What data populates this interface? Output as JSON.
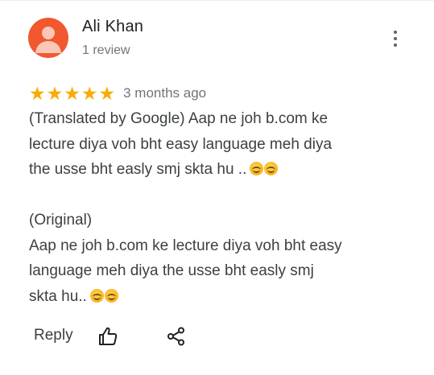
{
  "review": {
    "author_name": "Ali Khan",
    "review_count": "1 review",
    "rating": 5,
    "stars": [
      "★",
      "★",
      "★",
      "★",
      "★"
    ],
    "time_ago": "3 months ago",
    "translated_line1": "(Translated by Google) Aap ne joh b.com ke",
    "translated_line2": "lecture diya voh bht easy language meh diya",
    "translated_line3": "the usse bht easly smj skta hu ..",
    "original_label": "(Original)",
    "original_line1": "Aap ne joh b.com ke lecture diya voh bht easy",
    "original_line2": "language meh diya the usse bht easly smj",
    "original_line3": "skta hu..",
    "emoji": "smiling-face-with-smiling-eyes"
  },
  "actions": {
    "reply_label": "Reply",
    "like_icon": "thumbs-up-icon",
    "share_icon": "share-icon",
    "menu_icon": "more-vert-icon"
  },
  "colors": {
    "avatar_bg": "#f1582f",
    "star": "#f9ab00",
    "text": "#3c4043",
    "muted": "#70757a"
  }
}
